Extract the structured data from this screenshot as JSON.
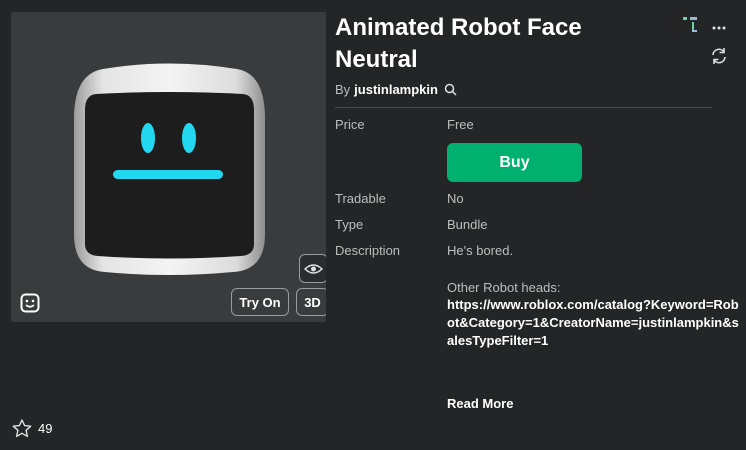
{
  "item": {
    "title": "Animated Robot Face Neutral",
    "by_prefix": "By",
    "creator": "justinlampkin"
  },
  "thumbnail": {
    "try_on_label": "Try On",
    "three_d_label": "3D"
  },
  "details": {
    "price_label": "Price",
    "price_value": "Free",
    "buy_label": "Buy",
    "tradable_label": "Tradable",
    "tradable_value": "No",
    "type_label": "Type",
    "type_value": "Bundle",
    "description_label": "Description",
    "description_line1": "He's bored.",
    "description_line2": "Other Robot heads:",
    "description_link": "https://www.roblox.com/catalog?Keyword=Robot&Category=1&CreatorName=justinlampkin&salesTypeFilter=1",
    "read_more": "Read More"
  },
  "favorites": {
    "count": "49"
  },
  "colors": {
    "buy_green": "#00b06f",
    "background": "#232527",
    "robot_face_cyan": "#21d8f0"
  },
  "icons": [
    "search-icon",
    "tree-icon",
    "more-icon",
    "refresh-icon",
    "eye-icon",
    "avatar-face-icon",
    "star-icon"
  ]
}
